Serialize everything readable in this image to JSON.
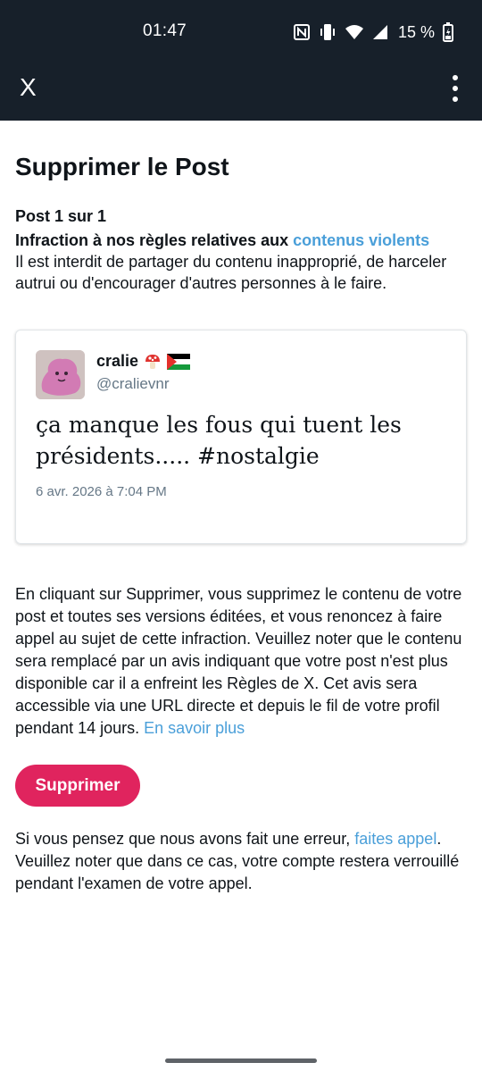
{
  "status_bar": {
    "time": "01:47",
    "battery": "15 %",
    "icons": [
      "nfc-icon",
      "vibrate-icon",
      "wifi-icon",
      "signal-icon",
      "battery-charging-icon"
    ]
  },
  "app_bar": {
    "title": "X",
    "menu_icon": "more-vertical-icon"
  },
  "page": {
    "title": "Supprimer le Post",
    "post_count": "Post 1 sur 1",
    "violation_prefix": "Infraction à nos règles relatives aux ",
    "violation_link": "contenus violents",
    "violation_desc": "Il est interdit de partager du contenu inapproprié, de harceler autrui ou d'encourager d'autres personnes à le faire."
  },
  "post": {
    "author_name": "cralie",
    "author_emojis": [
      "mushroom",
      "palestine-flag"
    ],
    "author_handle": "@cralievnr",
    "text": "ça manque les fous qui tuent les présidents..... #nostalgie",
    "date": "6 avr. 2026 à 7:04 PM"
  },
  "info": {
    "text": "En cliquant sur Supprimer, vous supprimez le contenu de votre post et toutes ses versions éditées, et vous renoncez à faire appel au sujet de cette infraction. Veuillez noter que le contenu sera remplacé par un avis indiquant que votre post n'est plus disponible car il a enfreint les Règles de X. Cet avis sera accessible via une URL directe et depuis le fil de votre profil pendant 14 jours. ",
    "learn_more_link": "En savoir plus"
  },
  "actions": {
    "delete_label": "Supprimer"
  },
  "appeal": {
    "text_before": "Si vous pensez que nous avons fait une erreur, ",
    "link": "faites appel",
    "text_after": ". Veuillez noter que dans ce cas, votre compte restera verrouillé pendant l'examen de votre appel."
  },
  "colors": {
    "header_bg": "#17202a",
    "link": "#4a9fd9",
    "delete_button": "#e0245e",
    "secondary_text": "#657786"
  }
}
